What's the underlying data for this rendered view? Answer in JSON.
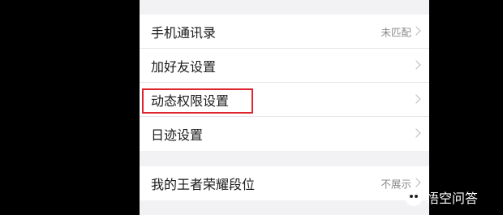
{
  "settings": {
    "group1": [
      {
        "label": "手机通讯录",
        "value": "未匹配"
      },
      {
        "label": "加好友设置",
        "value": ""
      },
      {
        "label": "动态权限设置",
        "value": ""
      },
      {
        "label": "日迹设置",
        "value": ""
      }
    ],
    "group2": [
      {
        "label": "我的王者荣耀段位",
        "value": "不展示"
      }
    ]
  },
  "watermark": {
    "text": "悟空问答"
  },
  "colors": {
    "highlight": "#e0242d",
    "background": "#f2f2f5"
  }
}
